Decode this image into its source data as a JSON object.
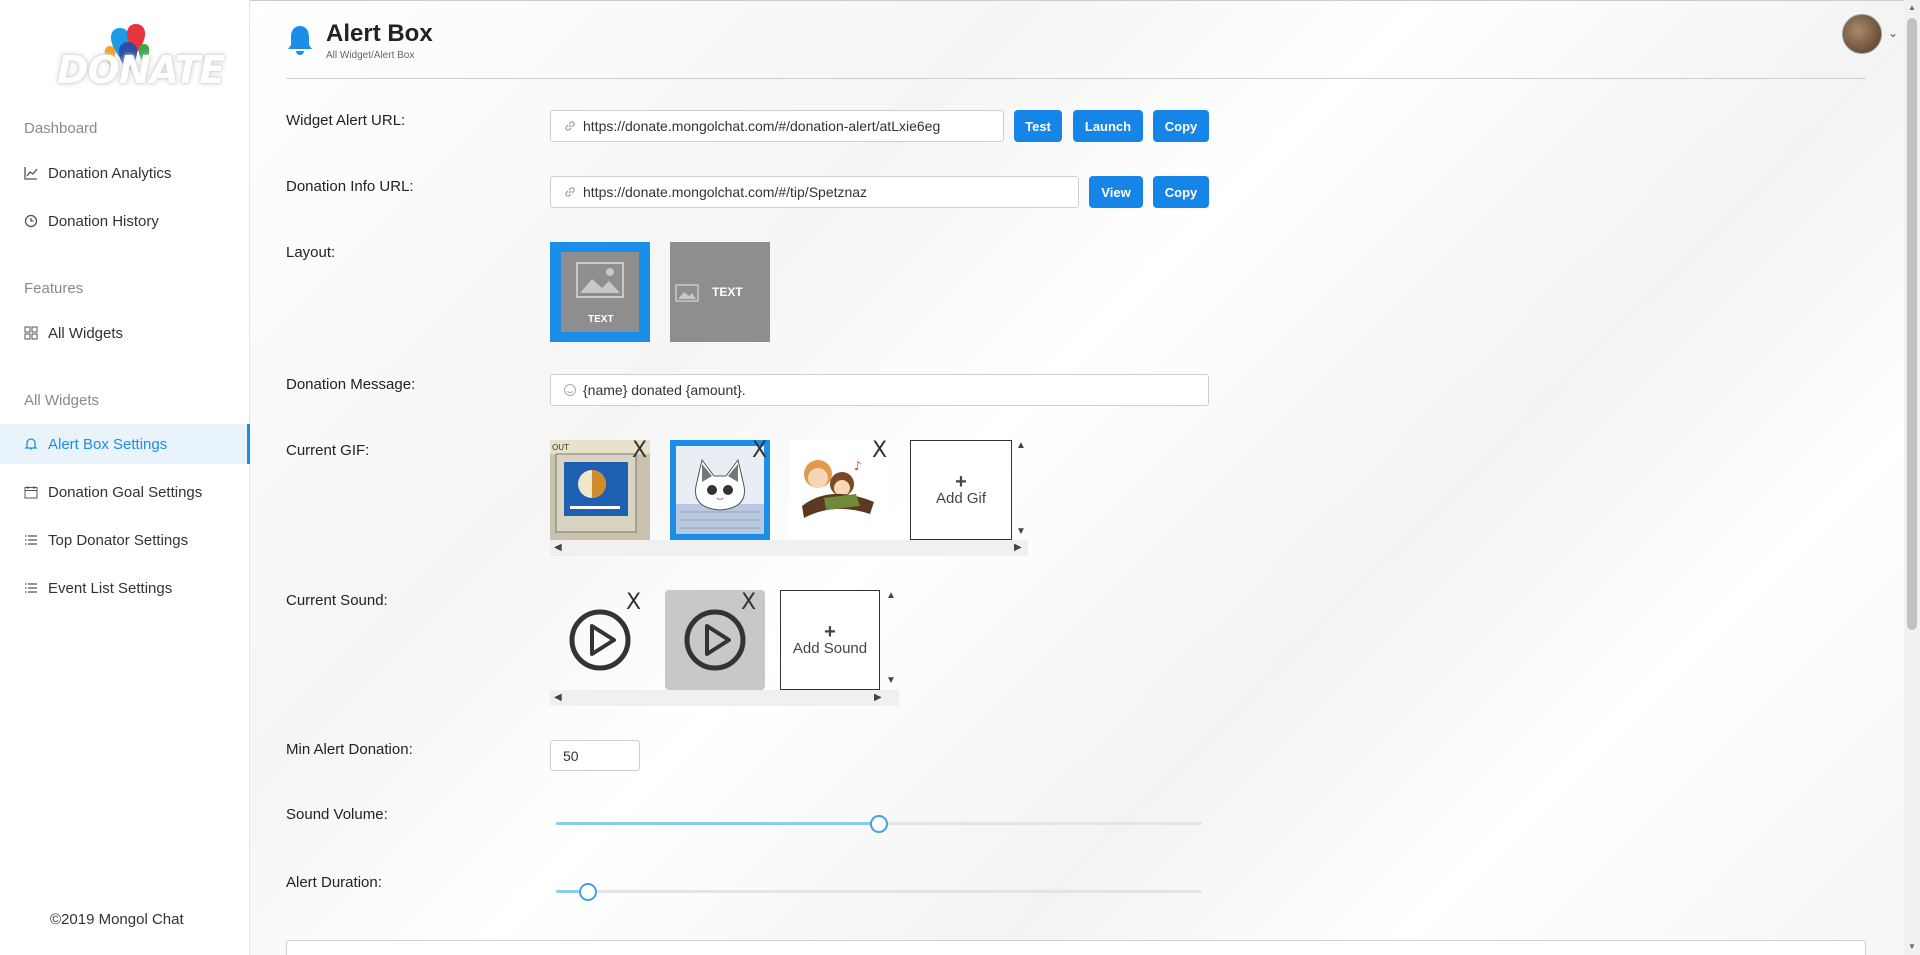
{
  "sidebar": {
    "logo_text": "DONATE",
    "sections": [
      {
        "title": "Dashboard",
        "items": [
          {
            "label": "Donation Analytics",
            "icon": "chart-line-icon"
          },
          {
            "label": "Donation History",
            "icon": "clock-icon"
          }
        ]
      },
      {
        "title": "Features",
        "items": [
          {
            "label": "All Widgets",
            "icon": "grid-icon"
          }
        ]
      },
      {
        "title": "All Widgets",
        "items": [
          {
            "label": "Alert Box Settings",
            "icon": "bell-icon",
            "active": true
          },
          {
            "label": "Donation Goal Settings",
            "icon": "calendar-icon"
          },
          {
            "label": "Top Donator Settings",
            "icon": "list-icon"
          },
          {
            "label": "Event List Settings",
            "icon": "list-icon"
          }
        ]
      }
    ],
    "footer": "©2019 Mongol Chat"
  },
  "header": {
    "title": "Alert Box",
    "breadcrumb": "All Widget/Alert Box"
  },
  "form": {
    "widget_alert_url": {
      "label": "Widget Alert URL:",
      "value": "https://donate.mongolchat.com/#/donation-alert/atLxie6eg",
      "buttons": [
        "Test",
        "Launch",
        "Copy"
      ]
    },
    "donation_info_url": {
      "label": "Donation Info URL:",
      "value": "https://donate.mongolchat.com/#/tip/Spetznaz",
      "buttons": [
        "View",
        "Copy"
      ]
    },
    "layout": {
      "label": "Layout:",
      "options": [
        "TEXT",
        "TEXT"
      ],
      "selected": 0
    },
    "donation_message": {
      "label": "Donation Message:",
      "value": "{name} donated {amount}."
    },
    "current_gif": {
      "label": "Current GIF:",
      "selected": 1,
      "add_label": "Add Gif",
      "close_glyph": "X"
    },
    "current_sound": {
      "label": "Current Sound:",
      "selected": 1,
      "add_label": "Add Sound"
    },
    "min_alert_donation": {
      "label": "Min Alert Donation:",
      "value": "50"
    },
    "sound_volume": {
      "label": "Sound Volume:",
      "value": 0.5
    },
    "alert_duration": {
      "label": "Alert Duration:",
      "value": 0.05
    }
  },
  "colors": {
    "accent": "#1585e8",
    "active_bg": "#e8f3fb",
    "slider_fill": "#8ccbee"
  }
}
